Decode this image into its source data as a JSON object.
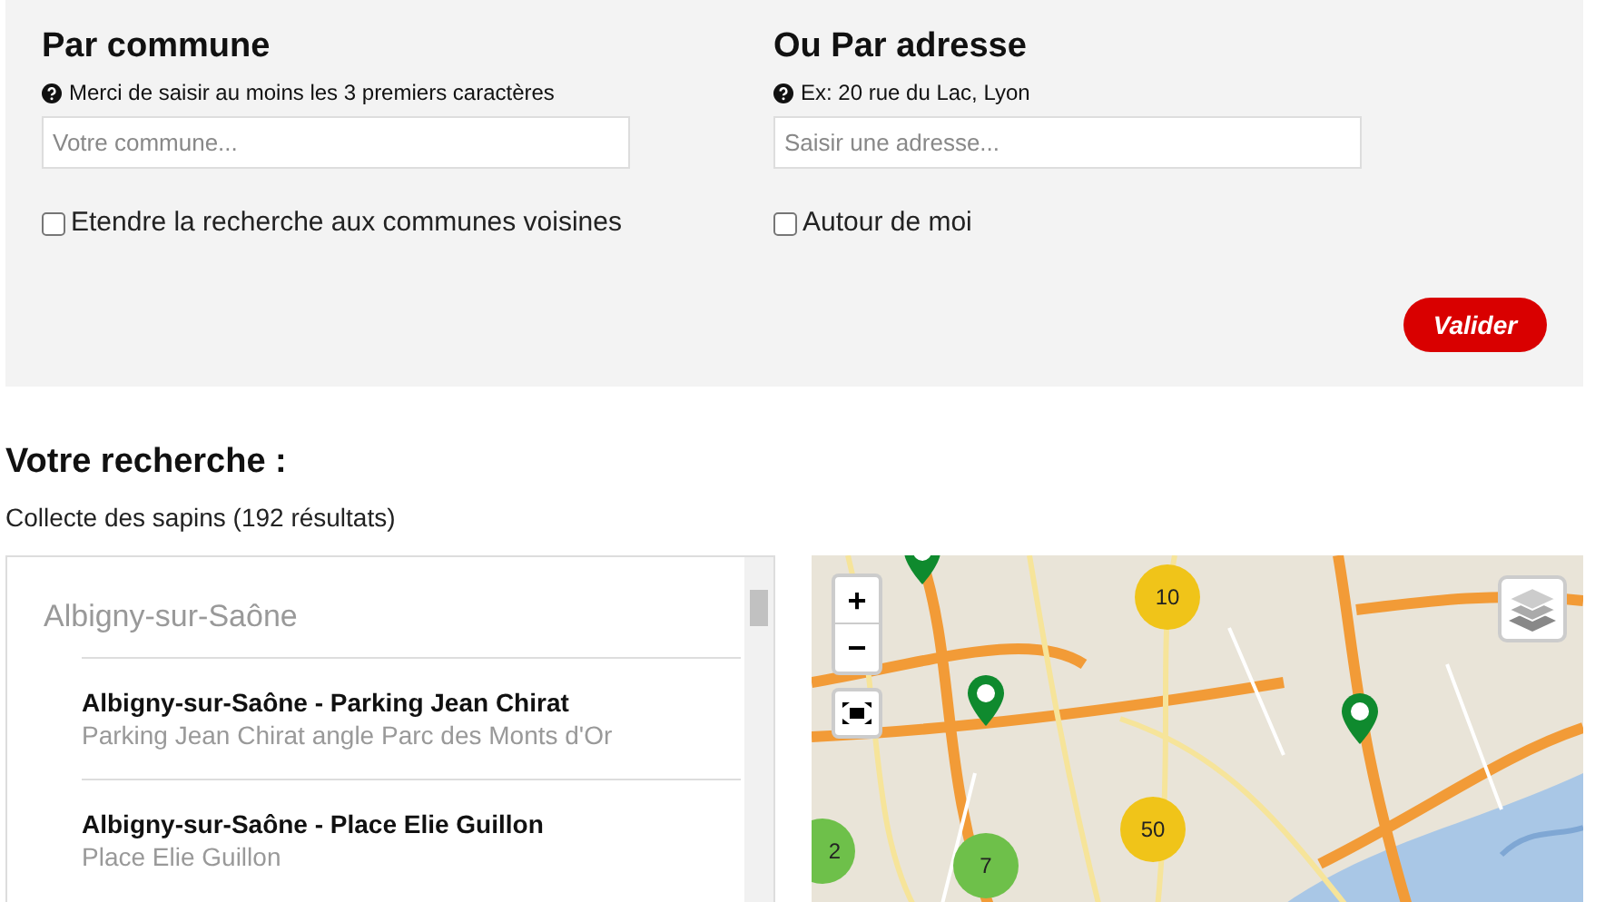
{
  "search_panel": {
    "by_commune": {
      "title": "Par commune",
      "hint": "Merci de saisir au moins les 3 premiers caractères",
      "placeholder": "Votre commune...",
      "checkbox": {
        "label": "Etendre la recherche aux communes voisines",
        "checked": false
      }
    },
    "by_address": {
      "title": "Ou Par adresse",
      "hint": "Ex: 20 rue du Lac, Lyon",
      "placeholder": "Saisir une adresse...",
      "checkbox": {
        "label": "Autour de moi",
        "checked": false
      }
    },
    "submit_button": "Valider"
  },
  "results": {
    "title": "Votre recherche :",
    "summary": "Collecte des sapins (192 résultats)",
    "groups": [
      {
        "name": "Albigny-sur-Saône",
        "items": [
          {
            "title": "Albigny-sur-Saône - Parking Jean Chirat",
            "address": "Parking Jean Chirat angle Parc des Monts d'Or"
          },
          {
            "title": "Albigny-sur-Saône - Place Elie Guillon",
            "address": "Place Elie Guillon"
          }
        ]
      }
    ]
  },
  "map": {
    "zoom_in": "+",
    "zoom_out": "−",
    "clusters": [
      {
        "count": "10",
        "color": "#f0c419"
      },
      {
        "count": "50",
        "color": "#f0c419"
      },
      {
        "count": "7",
        "color": "#6ec04a"
      },
      {
        "count": "2",
        "color": "#6ec04a"
      }
    ]
  }
}
